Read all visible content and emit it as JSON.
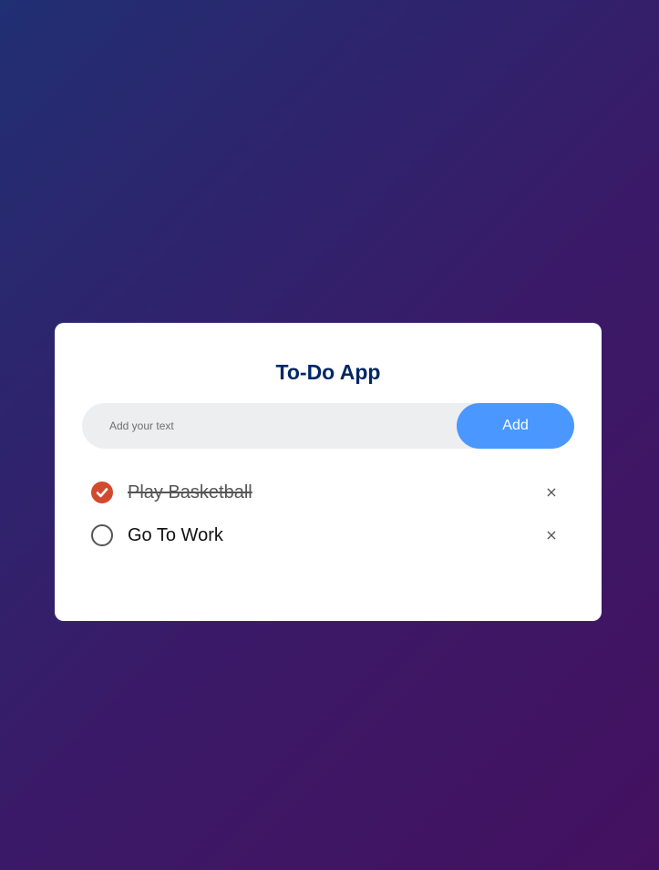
{
  "app": {
    "title": "To-Do App"
  },
  "input": {
    "placeholder": "Add your text",
    "value": ""
  },
  "add_button": {
    "label": "Add"
  },
  "tasks": [
    {
      "text": "Play Basketball",
      "done": true,
      "delete_icon": "close-icon",
      "delete_glyph": "×"
    },
    {
      "text": "Go To Work",
      "done": false,
      "delete_icon": "close-icon",
      "delete_glyph": "×"
    }
  ],
  "colors": {
    "title": "#002765",
    "accent": "#4a98ff",
    "checked": "#d24a2d",
    "background_start": "#212f73",
    "background_end": "#441160"
  }
}
